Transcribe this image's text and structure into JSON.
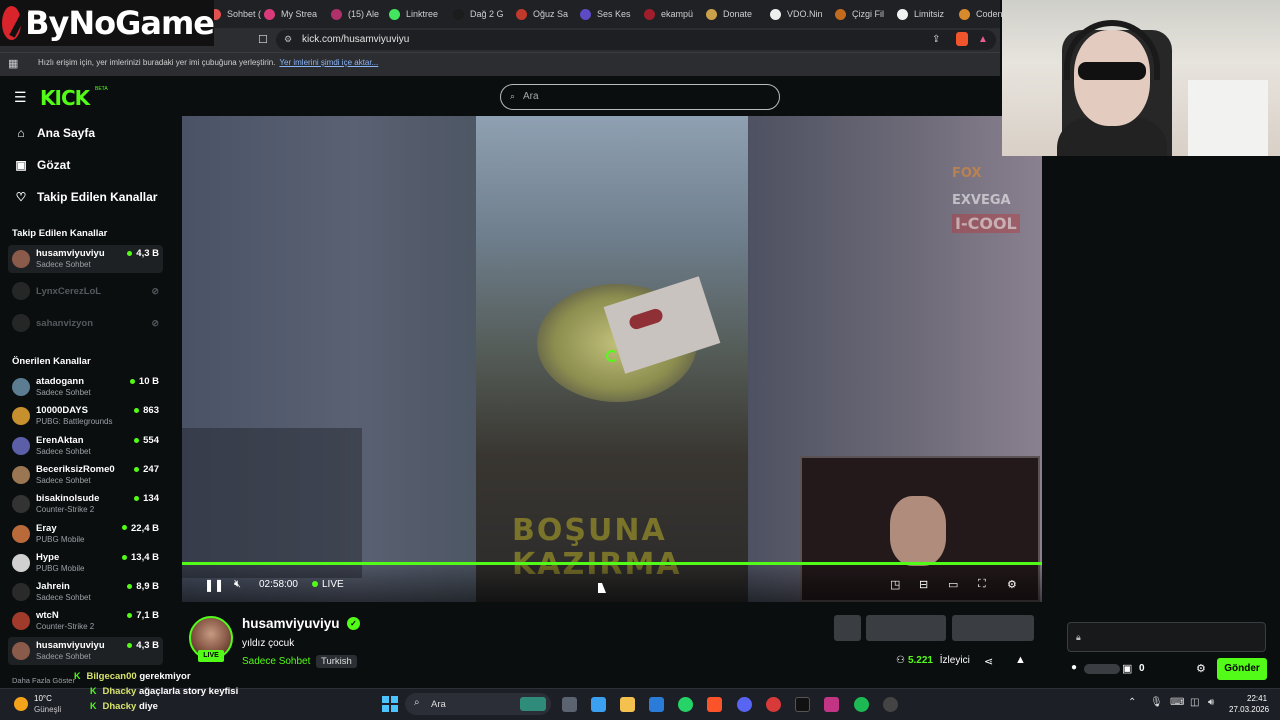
{
  "browser": {
    "tabs": [
      {
        "label": "Sohbet (",
        "color": "#e35050"
      },
      {
        "label": "My Strea",
        "color": "#d93a7a"
      },
      {
        "label": "(15) Ale",
        "color": "#b0316a"
      },
      {
        "label": "Linktree",
        "color": "#43e55e"
      },
      {
        "label": "Dağ 2 G",
        "color": "#1c1c1c"
      },
      {
        "label": "Oğuz Sa",
        "color": "#c0392b"
      },
      {
        "label": "Ses Kes",
        "color": "#5b4bc4"
      },
      {
        "label": "ekampü",
        "color": "#a01d2c"
      },
      {
        "label": "Donate",
        "color": "#caa14a"
      },
      {
        "label": "VDO.Nin",
        "color": "#eeeeee"
      },
      {
        "label": "Çizgi Fil",
        "color": "#c26b1e"
      },
      {
        "label": "Limitsiz",
        "color": "#f2f2f2"
      },
      {
        "label": "Codena",
        "color": "#d78a2c"
      }
    ],
    "url": "kick.com/husamviyuviyu",
    "bookmark_hint": "Hızlı erişim için, yer imlerinizi buradaki yer imi çubuğuna yerleştirin.",
    "bookmark_link": "Yer imlerini şimdi içe aktar..."
  },
  "overlay_logo": "ByNoGame",
  "kick": {
    "logo": "KICK",
    "beta": "BETA",
    "search_placeholder": "Ara"
  },
  "sidebar": {
    "nav": [
      {
        "label": "Ana Sayfa",
        "icon": "home-icon"
      },
      {
        "label": "Gözat",
        "icon": "browse-icon"
      },
      {
        "label": "Takip Edilen Kanallar",
        "icon": "heart-icon"
      }
    ],
    "followed_title": "Takip Edilen Kanallar",
    "followed": [
      {
        "name": "husamviyuviyu",
        "category": "Sadece Sohbet",
        "viewers": "4,3 B",
        "online": true,
        "color": "#8a5a4a"
      },
      {
        "name": "LynxCerezLoL",
        "category": "",
        "viewers": "",
        "online": false,
        "color": "#555"
      },
      {
        "name": "sahanvizyon",
        "category": "",
        "viewers": "",
        "online": false,
        "color": "#555"
      }
    ],
    "recommended_title": "Önerilen Kanallar",
    "recommended": [
      {
        "name": "atadogann",
        "category": "Sadece Sohbet",
        "viewers": "10 B",
        "color": "#5b7c91"
      },
      {
        "name": "10000DAYS",
        "category": "PUBG: Battlegrounds",
        "viewers": "863",
        "color": "#c5902d"
      },
      {
        "name": "ErenAktan",
        "category": "Sadece Sohbet",
        "viewers": "554",
        "color": "#5a5fa8"
      },
      {
        "name": "BeceriksizRome0",
        "category": "Sadece Sohbet",
        "viewers": "247",
        "color": "#9a7652"
      },
      {
        "name": "bisakinolsude",
        "category": "Counter-Strike 2",
        "viewers": "134",
        "color": "#333"
      },
      {
        "name": "Eray",
        "category": "PUBG Mobile",
        "viewers": "22,4 B",
        "color": "#b86a3a"
      },
      {
        "name": "Hype",
        "category": "PUBG Mobile",
        "viewers": "13,4 B",
        "color": "#d0d0d0"
      },
      {
        "name": "Jahrein",
        "category": "Sadece Sohbet",
        "viewers": "8,9 B",
        "color": "#2a2a2a"
      },
      {
        "name": "wtcN",
        "category": "Counter-Strike 2",
        "viewers": "7,1 B",
        "color": "#a03a2a"
      },
      {
        "name": "husamviyuviyu",
        "category": "Sadece Sohbet",
        "viewers": "4,3 B",
        "color": "#8a5a4a"
      }
    ],
    "show_more": "Daha Fazla Göster"
  },
  "player": {
    "elapsed": "02:58:00",
    "live_label": "LIVE",
    "overlay_line1": "BOŞUNA",
    "overlay_line2": "KAZIRMA",
    "sponsor1": "FOX",
    "sponsor2": "EXVEGA",
    "sponsor3": "I-COOL"
  },
  "stream": {
    "streamer": "husamviyuviyu",
    "live_badge": "LIVE",
    "title": "yıldız çocuk",
    "category": "Sadece Sohbet",
    "language": "Turkish",
    "viewers": "5.221",
    "viewers_label": "İzleyici"
  },
  "chat": {
    "points": "0",
    "send_label": "Gönder",
    "messages": [
      {
        "user": "Bilgecan00",
        "text": "gerekmiyor"
      },
      {
        "user": "Dhacky",
        "text": "ağaçlarla story keyfisi"
      },
      {
        "user": "Dhacky",
        "text": "diye"
      }
    ]
  },
  "taskbar": {
    "weather_temp": "10°C",
    "weather_desc": "Güneşli",
    "search_placeholder": "Ara",
    "time": "22:41",
    "date": "27.03.2026"
  }
}
